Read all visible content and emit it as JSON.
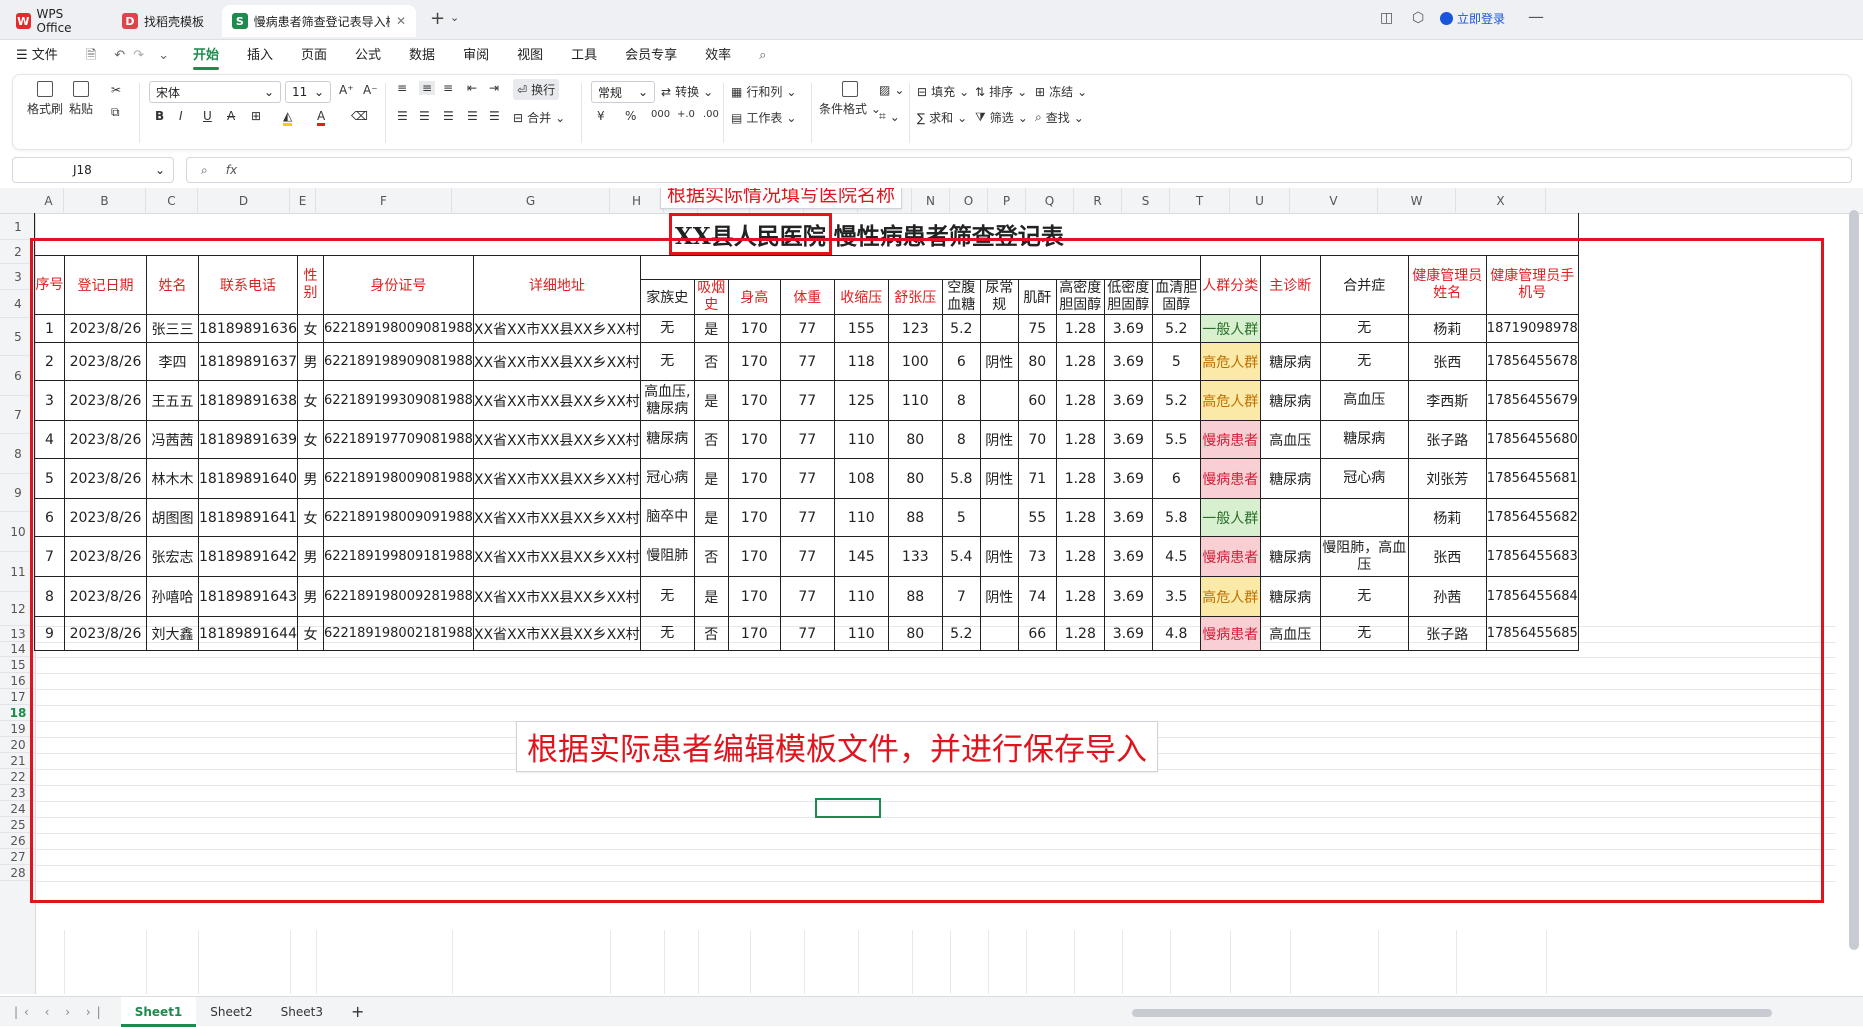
{
  "titlebar": {
    "tabs": [
      {
        "label": "WPS Office",
        "icon": "wps-icon"
      },
      {
        "label": "找稻壳模板",
        "icon": "docer-icon"
      },
      {
        "label": "慢病患者筛查登记表导入模板",
        "icon": "sheet-icon"
      }
    ],
    "new_tab": "+",
    "login": "立即登录"
  },
  "menu": {
    "file": "文件",
    "items": [
      "开始",
      "插入",
      "页面",
      "公式",
      "数据",
      "审阅",
      "视图",
      "工具",
      "会员专享",
      "效率"
    ],
    "active": "开始"
  },
  "ribbon": {
    "format_painter": "格式刷",
    "paste": "粘贴",
    "font_name": "宋体",
    "font_size": "11",
    "wrap": "换行",
    "merge": "合并",
    "number_format": "常规",
    "convert": "转换",
    "row_col": "行和列",
    "worksheet": "工作表",
    "cond_format": "条件格式",
    "fill": "填充",
    "sort": "排序",
    "freeze": "冻结",
    "sum": "求和",
    "filter": "筛选",
    "find": "查找",
    "currency": "¥",
    "percent": "%"
  },
  "formula_bar": {
    "cell_ref": "J18",
    "fx": "fx",
    "value": ""
  },
  "columns": [
    "A",
    "B",
    "C",
    "D",
    "E",
    "F",
    "G",
    "H",
    "I",
    "J",
    "K",
    "L",
    "M",
    "N",
    "O",
    "P",
    "Q",
    "R",
    "S",
    "T",
    "U",
    "V",
    "W",
    "X"
  ],
  "rows": [
    "1",
    "2",
    "3",
    "4",
    "5",
    "6",
    "7",
    "8",
    "9",
    "10",
    "11",
    "12",
    "13",
    "14",
    "15",
    "16",
    "17",
    "18",
    "19",
    "20",
    "21",
    "22",
    "23",
    "24",
    "25",
    "26",
    "27",
    "28"
  ],
  "sheet": {
    "title_hospital": "XX县人民医院",
    "title_rest": "慢性病患者筛查登记表",
    "headers": {
      "seq": "序号",
      "date": "登记日期",
      "name": "姓名",
      "phone": "联系电话",
      "gender": "性别",
      "idcard": "身份证号",
      "address": "详细地址",
      "family": "家族史",
      "smoke": "吸烟史",
      "height": "身高",
      "weight": "体重",
      "sbp": "收缩压",
      "dbp": "舒张压",
      "glucose": "空腹血糖",
      "urine": "尿常规",
      "creat": "肌酐",
      "hdl": "高密度胆固醇",
      "ldl": "低密度胆固醇",
      "chol": "血清胆固醇",
      "crowd": "人群分类",
      "diag": "主诊断",
      "comp": "合并症",
      "mgr_name": "健康管理员姓名",
      "mgr_phone": "健康管理员手机号"
    },
    "records": [
      [
        "1",
        "2023/8/26",
        "张三三",
        "18189891636",
        "女",
        "622189198009081988",
        "XX省XX市XX县XX乡XX村",
        "无",
        "是",
        "170",
        "77",
        "155",
        "123",
        "5.2",
        "",
        "75",
        "1.28",
        "3.69",
        "5.2",
        "一般人群",
        "",
        "无",
        "杨莉",
        "18719098978"
      ],
      [
        "2",
        "2023/8/26",
        "李四",
        "18189891637",
        "男",
        "622189198909081988",
        "XX省XX市XX县XX乡XX村",
        "无",
        "否",
        "170",
        "77",
        "118",
        "100",
        "6",
        "阴性",
        "80",
        "1.28",
        "3.69",
        "5",
        "高危人群",
        "糖尿病",
        "无",
        "张西",
        "17856455678"
      ],
      [
        "3",
        "2023/8/26",
        "王五五",
        "18189891638",
        "女",
        "622189199309081988",
        "XX省XX市XX县XX乡XX村",
        "高血压,糖尿病",
        "是",
        "170",
        "77",
        "125",
        "110",
        "8",
        "",
        "60",
        "1.28",
        "3.69",
        "5.2",
        "高危人群",
        "糖尿病",
        "高血压",
        "李西斯",
        "17856455679"
      ],
      [
        "4",
        "2023/8/26",
        "冯茜茜",
        "18189891639",
        "女",
        "622189197709081988",
        "XX省XX市XX县XX乡XX村",
        "糖尿病",
        "否",
        "170",
        "77",
        "110",
        "80",
        "8",
        "阴性",
        "70",
        "1.28",
        "3.69",
        "5.5",
        "慢病患者",
        "高血压",
        "糖尿病",
        "张子路",
        "17856455680"
      ],
      [
        "5",
        "2023/8/26",
        "林木木",
        "18189891640",
        "男",
        "622189198009081988",
        "XX省XX市XX县XX乡XX村",
        "冠心病",
        "是",
        "170",
        "77",
        "108",
        "80",
        "5.8",
        "阴性",
        "71",
        "1.28",
        "3.69",
        "6",
        "慢病患者",
        "糖尿病",
        "冠心病",
        "刘张芳",
        "17856455681"
      ],
      [
        "6",
        "2023/8/26",
        "胡图图",
        "18189891641",
        "女",
        "622189198009091988",
        "XX省XX市XX县XX乡XX村",
        "脑卒中",
        "是",
        "170",
        "77",
        "110",
        "88",
        "5",
        "",
        "55",
        "1.28",
        "3.69",
        "5.8",
        "一般人群",
        "",
        "",
        "杨莉",
        "17856455682"
      ],
      [
        "7",
        "2023/8/26",
        "张宏志",
        "18189891642",
        "男",
        "622189199809181988",
        "XX省XX市XX县XX乡XX村",
        "慢阻肺",
        "否",
        "170",
        "77",
        "145",
        "133",
        "5.4",
        "阴性",
        "73",
        "1.28",
        "3.69",
        "4.5",
        "慢病患者",
        "糖尿病",
        "慢阻肺，高血压",
        "张西",
        "17856455683"
      ],
      [
        "8",
        "2023/8/26",
        "孙嘻哈",
        "18189891643",
        "男",
        "622189198009281988",
        "XX省XX市XX县XX乡XX村",
        "无",
        "是",
        "170",
        "77",
        "110",
        "88",
        "7",
        "阴性",
        "74",
        "1.28",
        "3.69",
        "3.5",
        "高危人群",
        "糖尿病",
        "无",
        "孙茜",
        "17856455684"
      ],
      [
        "9",
        "2023/8/26",
        "刘大鑫",
        "18189891644",
        "女",
        "622189198002181988",
        "XX省XX市XX县XX乡XX村",
        "无",
        "否",
        "170",
        "77",
        "110",
        "80",
        "5.2",
        "",
        "66",
        "1.28",
        "3.69",
        "4.8",
        "慢病患者",
        "高血压",
        "无",
        "张子路",
        "17856455685"
      ]
    ]
  },
  "annotations": {
    "top": "根据实际情况填写医院名称",
    "bottom": "根据实际患者编辑模板文件，并进行保存导入"
  },
  "sheet_tabs": [
    "Sheet1",
    "Sheet2",
    "Sheet3"
  ],
  "active_sheet": "Sheet1",
  "colors": {
    "accent": "#1e8b4e",
    "annotation": "#e0141e",
    "crowd_general": "#d8f0d0",
    "crowd_high_risk": "#fbe9a8",
    "crowd_patient": "#f8cfd2"
  }
}
